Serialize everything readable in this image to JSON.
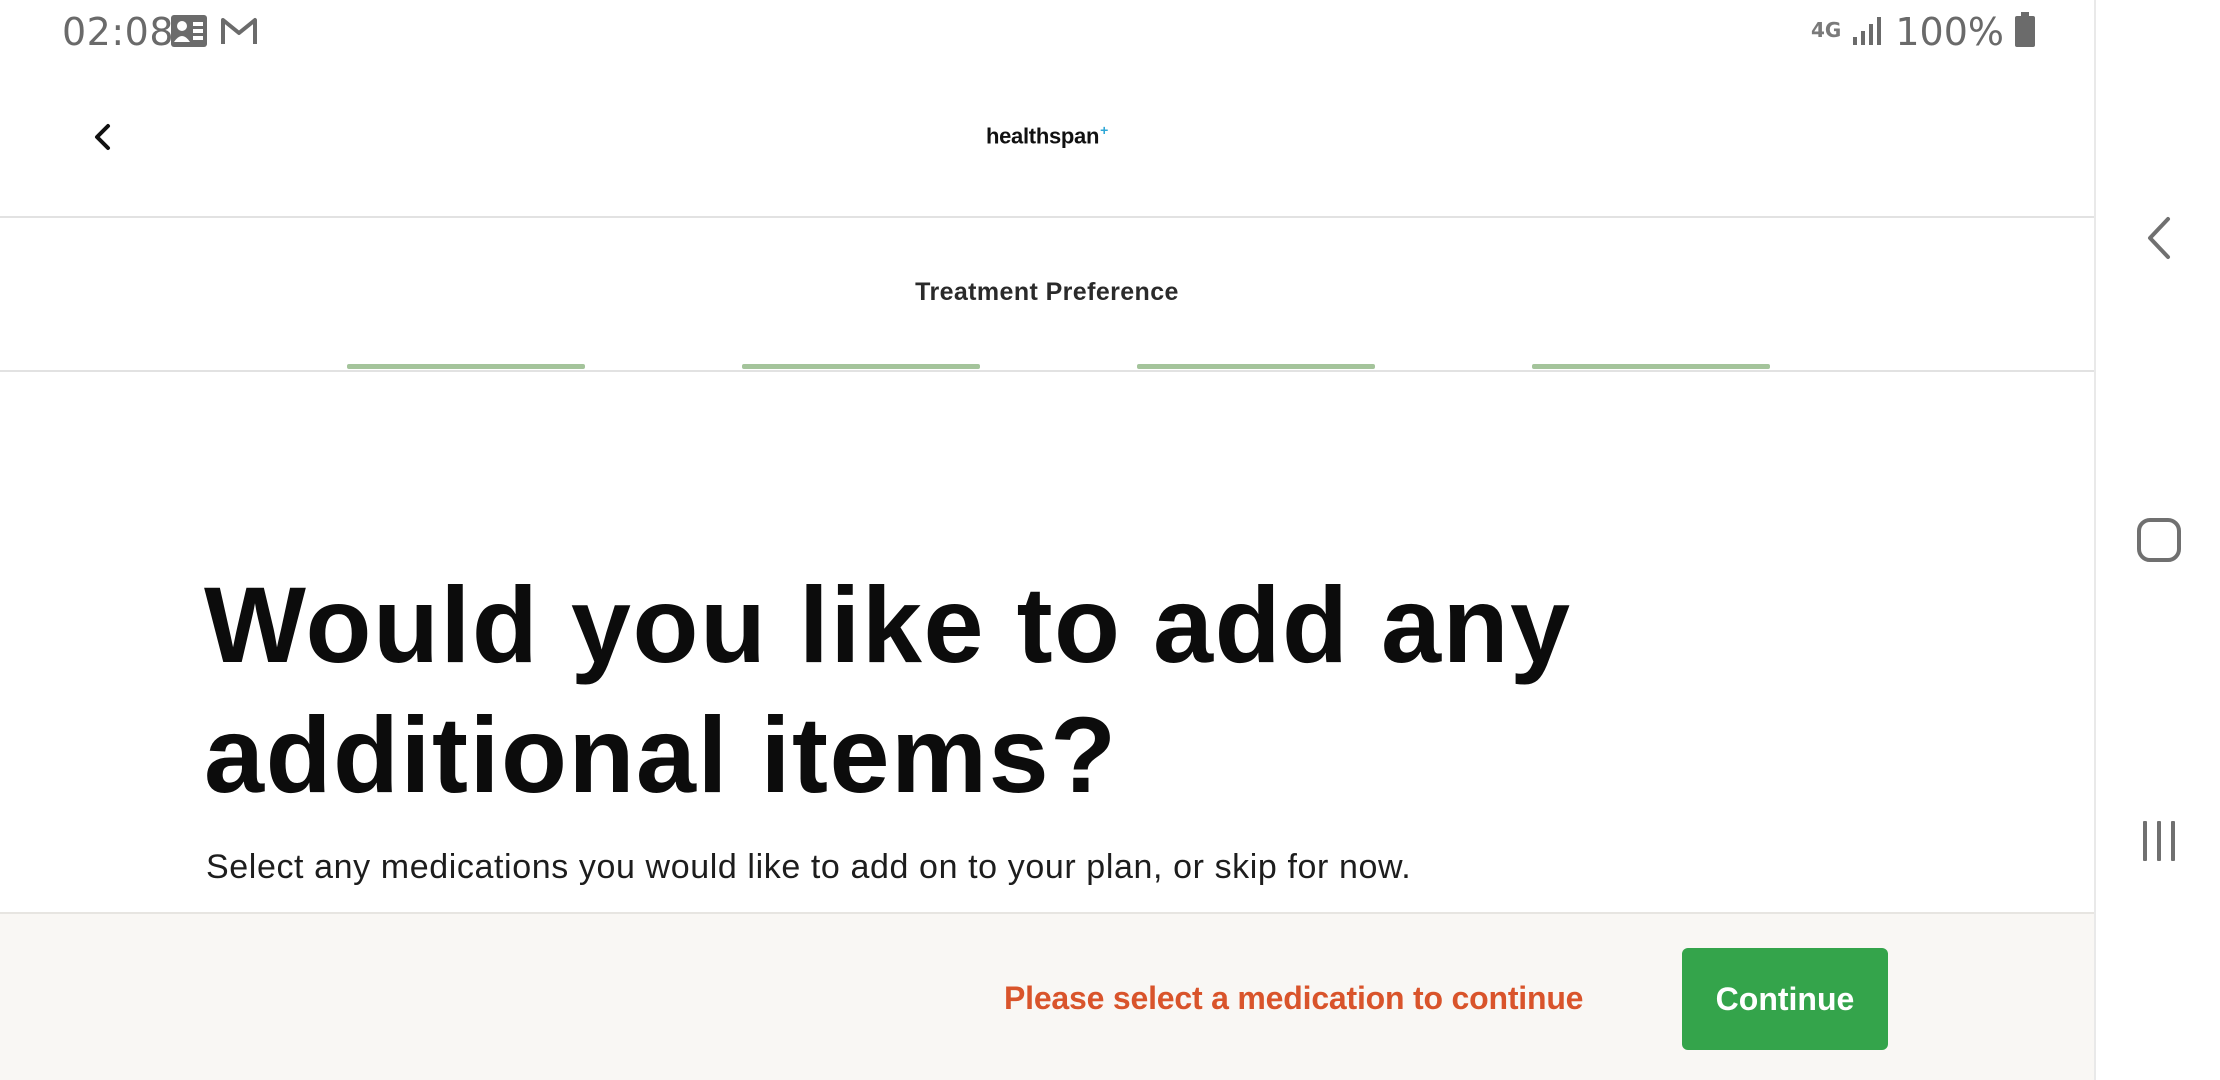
{
  "status_bar": {
    "time": "02:08",
    "network": "4G",
    "battery": "100%"
  },
  "header": {
    "logo_text": "healthspan",
    "logo_mark": "+"
  },
  "step": {
    "title": "Treatment Preference",
    "progress_segments": 4
  },
  "content": {
    "heading_line1": "Would you like to add any",
    "heading_line2": "additional items?",
    "subtext": "Select any medications you would like to add on to your plan, or skip for now."
  },
  "footer": {
    "message": "Please select a medication to continue",
    "continue_label": "Continue"
  },
  "colors": {
    "accent_green": "#34a44b",
    "warning_orange": "#d9542b",
    "progress_green": "#a4c49b",
    "logo_plus": "#2fa7d6"
  },
  "icons": {
    "back": "chevron-left-icon",
    "nav_back": "nav-back-icon",
    "nav_home": "nav-home-icon",
    "nav_recents": "nav-recents-icon"
  }
}
